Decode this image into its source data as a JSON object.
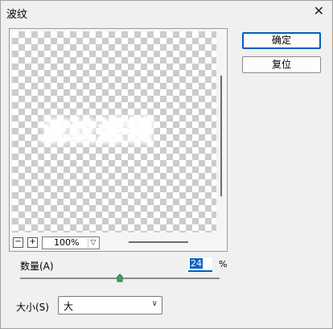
{
  "window": {
    "title": "波纹",
    "close_glyph": "✕"
  },
  "preview": {
    "sample_text": "波纹滤镜",
    "zoom": "100%",
    "zoom_out": "−",
    "zoom_in": "+"
  },
  "buttons": {
    "ok": "确定",
    "reset": "复位"
  },
  "amount": {
    "label": "数量(A)",
    "value": "24",
    "unit": "%",
    "slider_fraction": 0.5
  },
  "size": {
    "label": "大小(S)",
    "selected": "大"
  },
  "colors": {
    "accent": "#0060c0",
    "selection": "#0a64c8",
    "thumb": "#3aa857"
  }
}
